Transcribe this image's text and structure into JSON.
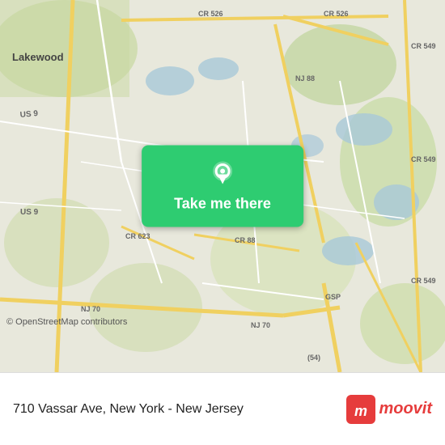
{
  "map": {
    "alt": "Map of 710 Vassar Ave area, New Jersey",
    "copyright": "© OpenStreetMap contributors",
    "pin_icon": "location-pin"
  },
  "button": {
    "label": "Take me there",
    "icon": "location-pin-icon",
    "bg_color": "#2ecc71"
  },
  "bottom_bar": {
    "address": "710 Vassar Ave, New York - New Jersey",
    "logo_text": "moovit",
    "logo_icon": "moovit-icon"
  }
}
